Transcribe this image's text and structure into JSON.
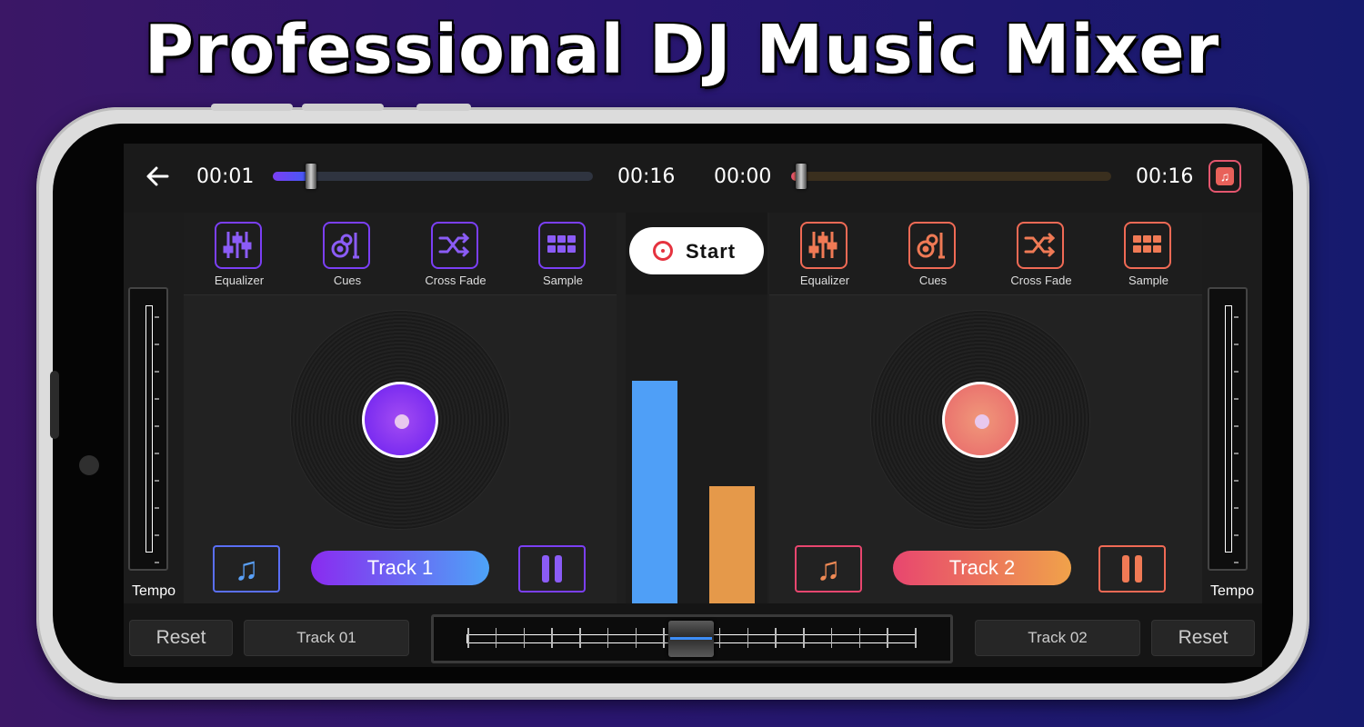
{
  "headline": "Professional DJ Music Mixer",
  "topbar": {
    "left_current": "00:01",
    "left_total": "00:16",
    "left_progress": 0.12,
    "right_current": "00:00",
    "right_total": "00:16",
    "right_progress": 0.03,
    "back_icon": "arrow-left-icon",
    "music_icon": "music-note-icon"
  },
  "colors": {
    "deck1_accent": "#7b3ff5",
    "deck1_track_gradient": [
      "#8a2bf0",
      "#4da3f7"
    ],
    "deck2_accent": "#f06a55",
    "deck2_track_gradient": [
      "#e8466f",
      "#f0a24a"
    ],
    "meter_left": "#4f9ff7",
    "meter_right": "#e5994a"
  },
  "deck1": {
    "effects": [
      {
        "label": "Equalizer",
        "icon": "equalizer-sliders-icon"
      },
      {
        "label": "Cues",
        "icon": "cues-icon"
      },
      {
        "label": "Cross Fade",
        "icon": "shuffle-icon"
      },
      {
        "label": "Sample",
        "icon": "sample-grid-icon"
      }
    ],
    "track_label": "Track 1",
    "load_icon": "music-note-icon",
    "pause_icon": "pause-icon"
  },
  "deck2": {
    "effects": [
      {
        "label": "Equalizer",
        "icon": "equalizer-sliders-icon"
      },
      {
        "label": "Cues",
        "icon": "cues-icon"
      },
      {
        "label": "Cross Fade",
        "icon": "shuffle-icon"
      },
      {
        "label": "Sample",
        "icon": "sample-grid-icon"
      }
    ],
    "track_label": "Track 2",
    "load_icon": "music-note-icon",
    "pause_icon": "pause-icon"
  },
  "center": {
    "start_label": "Start",
    "meter_left_level": 0.72,
    "meter_right_level": 0.38
  },
  "tempo": {
    "left_label": "Tempo",
    "right_label": "Tempo"
  },
  "bottombar": {
    "reset_left": "Reset",
    "track_left": "Track 01",
    "track_right": "Track 02",
    "reset_right": "Reset",
    "crossfader_position": 0.5
  }
}
